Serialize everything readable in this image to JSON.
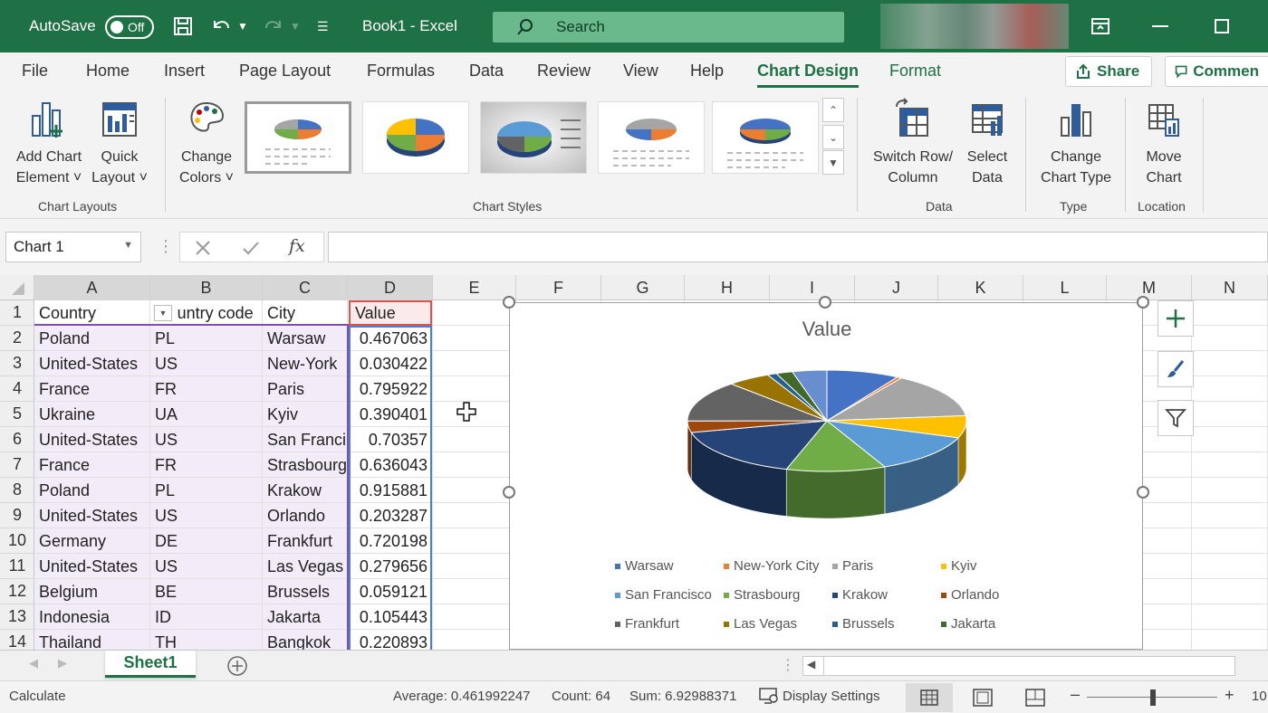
{
  "titlebar": {
    "autosave_label": "AutoSave",
    "autosave_state": "Off",
    "doc_title": "Book1  -  Excel",
    "search_placeholder": "Search"
  },
  "menu": {
    "tabs": [
      "File",
      "Home",
      "Insert",
      "Page Layout",
      "Formulas",
      "Data",
      "Review",
      "View",
      "Help",
      "Chart Design",
      "Format"
    ],
    "active_tab": "Chart Design",
    "share_label": "Share",
    "comments_label": "Commen"
  },
  "ribbon": {
    "add_chart_element": [
      "Add Chart",
      "Element ˅"
    ],
    "quick_layout": [
      "Quick",
      "Layout ˅"
    ],
    "change_colors": [
      "Change",
      "Colors ˅"
    ],
    "switch_row_col": [
      "Switch Row/",
      "Column"
    ],
    "select_data": [
      "Select",
      "Data"
    ],
    "change_chart_type": [
      "Change",
      "Chart Type"
    ],
    "move_chart": [
      "Move",
      "Chart"
    ],
    "groups": {
      "chart_layouts": "Chart Layouts",
      "chart_styles": "Chart Styles",
      "data": "Data",
      "type": "Type",
      "location": "Location"
    }
  },
  "formula_bar": {
    "name_box": "Chart 1",
    "fx": "fx",
    "value": ""
  },
  "grid": {
    "columns": [
      "A",
      "B",
      "C",
      "D",
      "E",
      "F",
      "G",
      "H",
      "I",
      "J",
      "K",
      "L",
      "M",
      "N"
    ],
    "rows": [
      "1",
      "2",
      "3",
      "4",
      "5",
      "6",
      "7",
      "8",
      "9",
      "10",
      "11",
      "12",
      "13",
      "14"
    ],
    "headers": [
      "Country",
      " untry code",
      "City",
      "Value"
    ],
    "data": [
      [
        "Poland",
        "PL",
        "Warsaw",
        "0.467063"
      ],
      [
        "United-States",
        "US",
        "New-York",
        "0.030422"
      ],
      [
        "France",
        "FR",
        "Paris",
        "0.795922"
      ],
      [
        "Ukraine",
        "UA",
        "Kyiv",
        "0.390401"
      ],
      [
        "United-States",
        "US",
        "San Franci",
        "0.70357"
      ],
      [
        "France",
        "FR",
        "Strasbourg",
        "0.636043"
      ],
      [
        "Poland",
        "PL",
        "Krakow",
        "0.915881"
      ],
      [
        "United-States",
        "US",
        "Orlando",
        "0.203287"
      ],
      [
        "Germany",
        "DE",
        "Frankfurt",
        "0.720198"
      ],
      [
        "United-States",
        "US",
        "Las Vegas",
        "0.279656"
      ],
      [
        "Belgium",
        "BE",
        "Brussels",
        "0.059121"
      ],
      [
        "Indonesia",
        "ID",
        "Jakarta",
        "0.105443"
      ],
      [
        "Thailand",
        "TH",
        "Bangkok",
        "0.220893"
      ]
    ]
  },
  "chart_data": {
    "type": "pie",
    "title": "Value",
    "categories": [
      "Warsaw",
      "New-York City",
      "Paris",
      "Kyiv",
      "San Francisco",
      "Strasbourg",
      "Krakow",
      "Orlando",
      "Frankfurt",
      "Las Vegas",
      "Brussels",
      "Jakarta",
      "Bangkok"
    ],
    "values": [
      0.467063,
      0.030422,
      0.795922,
      0.390401,
      0.70357,
      0.636043,
      0.915881,
      0.203287,
      0.720198,
      0.279656,
      0.059121,
      0.105443,
      0.220893
    ],
    "legend": [
      "Warsaw",
      "New-York City",
      "Paris",
      "Kyiv",
      "San Francisco",
      "Strasbourg",
      "Krakow",
      "Orlando",
      "Frankfurt",
      "Las Vegas",
      "Brussels",
      "Jakarta"
    ],
    "colors": [
      "#4472c4",
      "#ed7d31",
      "#a5a5a5",
      "#ffc000",
      "#5b9bd5",
      "#70ad47",
      "#264478",
      "#9e480e",
      "#636363",
      "#997300",
      "#255e91",
      "#43682b",
      "#698ed0"
    ],
    "legend_position": "bottom"
  },
  "sheets": {
    "active": "Sheet1"
  },
  "status": {
    "mode": "Calculate",
    "average": "Average: 0.461992247",
    "count": "Count: 64",
    "sum": "Sum: 6.92988371",
    "display_settings": "Display Settings",
    "zoom_minus": "–",
    "zoom_plus": "+",
    "zoom": "10"
  },
  "colors": {
    "excel_green": "#1e7145",
    "table_fill": "#f1ecf7",
    "value_col_border": "#4a7fd4"
  }
}
